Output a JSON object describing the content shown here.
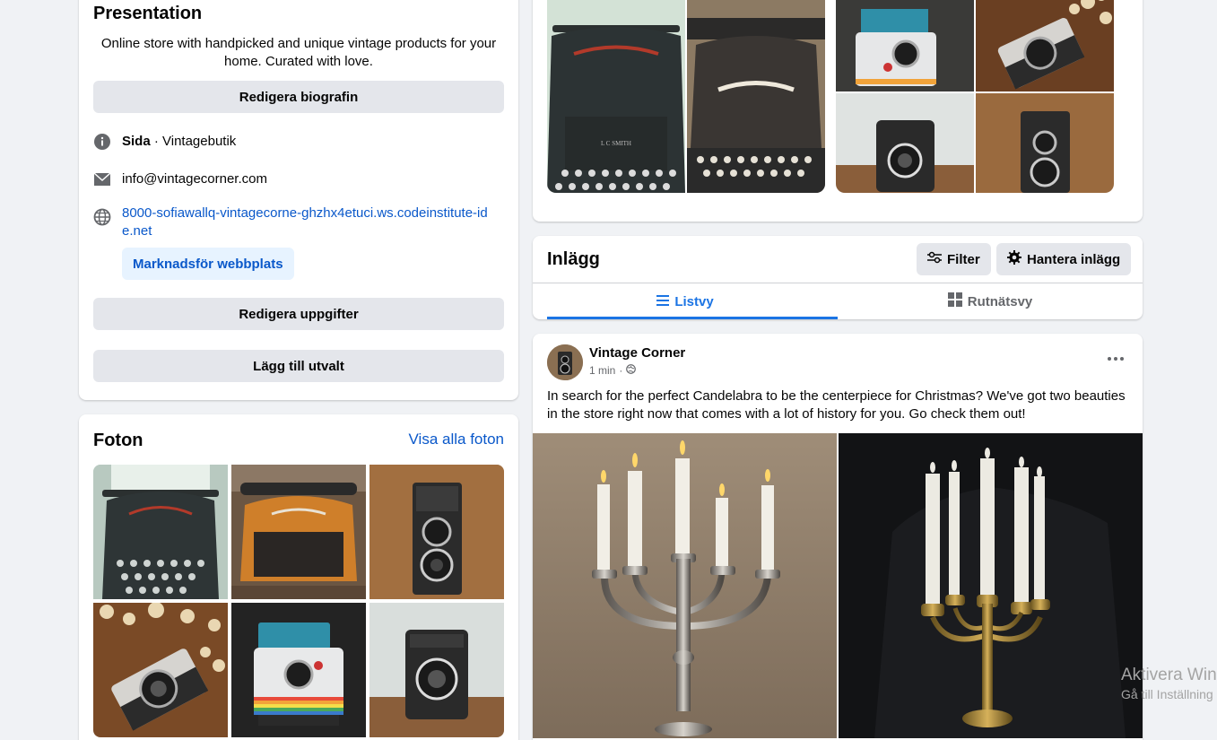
{
  "intro": {
    "title": "Presentation",
    "bio": "Online store with handpicked and unique vintage products for your home. Curated with love.",
    "edit_bio_label": "Redigera biografin",
    "page_type_bold": "Sida",
    "page_type_rest": " · Vintagebutik",
    "email": "info@vintagecorner.com",
    "website": "8000-sofiawallq-vintagecorne-ghzhx4etuci.ws.codeinstitute-ide.net",
    "promote_label": "Marknadsför webbplats",
    "edit_details_label": "Redigera uppgifter",
    "add_featured_label": "Lägg till utvalt"
  },
  "photos": {
    "title": "Foton",
    "see_all": "Visa alla foton"
  },
  "posts": {
    "title": "Inlägg",
    "filter_label": "Filter",
    "manage_label": "Hantera inlägg",
    "tab_list": "Listvy",
    "tab_grid": "Rutnätsvy"
  },
  "post": {
    "author": "Vintage Corner",
    "time": "1 min",
    "text": "In search for the perfect Candelabra to be the centerpiece for Christmas? We've got two beauties in the store right now that comes with a lot of history for you. Go check them out!"
  },
  "watermark": {
    "line1": "Aktivera Win",
    "line2": "Gå till Inställning"
  },
  "icons": [
    "info-icon",
    "mail-icon",
    "globe-icon",
    "filter-icon",
    "gear-icon",
    "list-icon",
    "grid-icon",
    "more-icon",
    "public-icon"
  ],
  "colors": {
    "accent": "#1b74e4",
    "link": "#0a58ca",
    "background": "#f0f2f5"
  }
}
